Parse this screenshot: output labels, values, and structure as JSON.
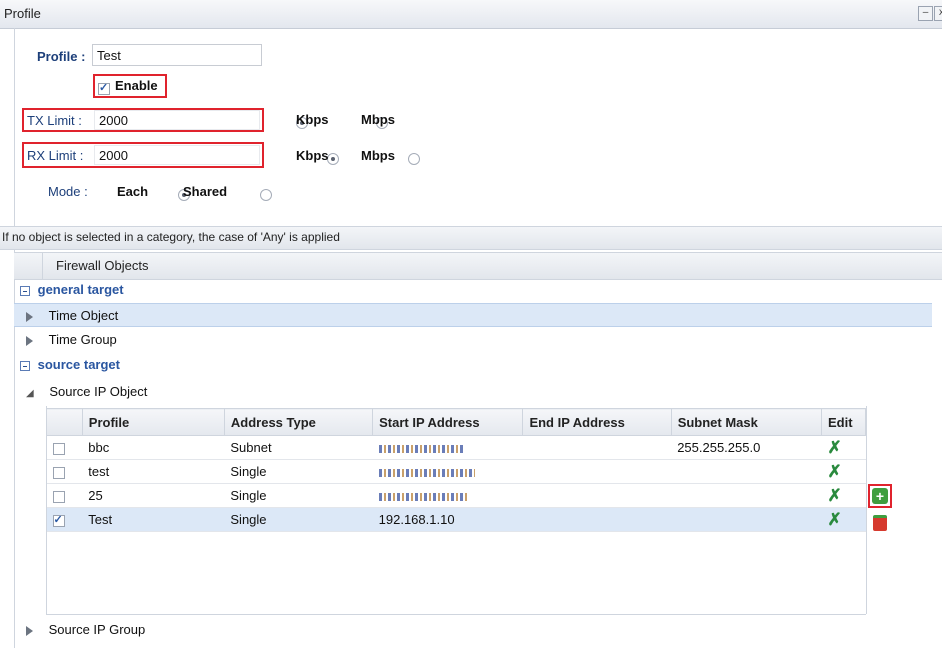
{
  "window": {
    "title": "Profile",
    "minimize_label": "–",
    "close_label": "x"
  },
  "form": {
    "profile_label": "Profile :",
    "profile_value": "Test",
    "enable_label": "Enable",
    "enable_checked": true,
    "tx_label": "TX Limit :",
    "tx_value": "2000",
    "rx_label": "RX Limit :",
    "rx_value": "2000",
    "unit_kbps": "Kbps",
    "unit_mbps": "Mbps",
    "mode_label": "Mode :",
    "mode_each": "Each",
    "mode_shared": "Shared"
  },
  "notice": "If no object is selected in a category, the case of 'Any' is applied",
  "tree": {
    "header": "Firewall Objects",
    "general_target": "general target",
    "time_object": "Time Object",
    "time_group": "Time Group",
    "source_target": "source target",
    "source_ip_object": "Source IP Object",
    "source_ip_group": "Source IP Group"
  },
  "table": {
    "columns": [
      "Profile",
      "Address Type",
      "Start IP Address",
      "End IP Address",
      "Subnet Mask",
      "Edit"
    ],
    "rows": [
      {
        "profile": "bbc",
        "type": "Subnet",
        "start_ip": "",
        "end_ip": "",
        "mask": "255.255.255.0",
        "checked": false
      },
      {
        "profile": "test",
        "type": "Single",
        "start_ip": "",
        "end_ip": "",
        "mask": "",
        "checked": false
      },
      {
        "profile": "25",
        "type": "Single",
        "start_ip": "",
        "end_ip": "",
        "mask": "",
        "checked": false
      },
      {
        "profile": "Test",
        "type": "Single",
        "start_ip": "192.168.1.10",
        "end_ip": "",
        "mask": "",
        "checked": true
      }
    ]
  },
  "colors": {
    "highlight": "#e0232d",
    "selected_row": "#dce8f7",
    "label_blue": "#1d3f7a",
    "edit_green": "#2a8a3e"
  }
}
